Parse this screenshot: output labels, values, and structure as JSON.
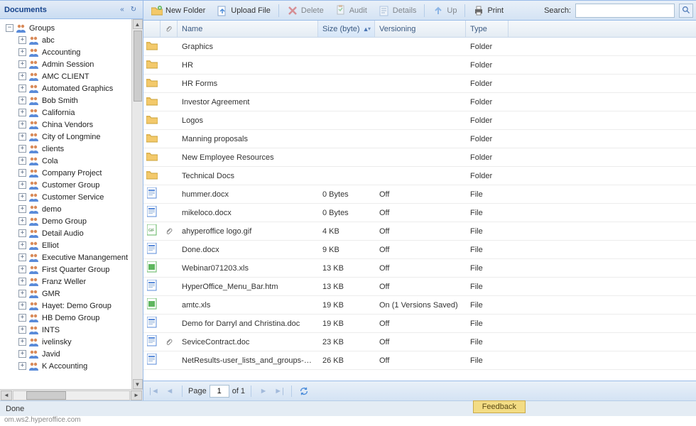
{
  "sidebar": {
    "title": "Documents",
    "root": "Groups",
    "items": [
      "abc",
      "Accounting",
      "Admin Session",
      "AMC CLIENT",
      "Automated Graphics",
      "Bob Smith",
      "California",
      "China Vendors",
      "City of Longmine",
      "clients",
      "Cola",
      "Company Project",
      "Customer Group",
      "Customer Service",
      "demo",
      "Demo Group",
      "Detail Audio",
      "Elliot",
      "Executive Manangement",
      "First Quarter Group",
      "Franz Weller",
      "GMR",
      "Hayet: Demo Group",
      "HB Demo Group",
      "INTS",
      "ivelinsky",
      "Javid",
      "K Accounting"
    ]
  },
  "toolbar": {
    "new_folder": "New Folder",
    "upload_file": "Upload File",
    "delete": "Delete",
    "audit": "Audit",
    "details": "Details",
    "up": "Up",
    "print": "Print",
    "search_label": "Search:",
    "search_placeholder": ""
  },
  "grid": {
    "columns": {
      "name": "Name",
      "size": "Size (byte)",
      "versioning": "Versioning",
      "type": "Type"
    },
    "rows": [
      {
        "icon": "folder",
        "name": "Graphics",
        "size": "",
        "versioning": "",
        "type": "Folder",
        "clip": false
      },
      {
        "icon": "folder",
        "name": "HR",
        "size": "",
        "versioning": "",
        "type": "Folder",
        "clip": false
      },
      {
        "icon": "folder",
        "name": "HR Forms",
        "size": "",
        "versioning": "",
        "type": "Folder",
        "clip": false
      },
      {
        "icon": "folder",
        "name": "Investor Agreement",
        "size": "",
        "versioning": "",
        "type": "Folder",
        "clip": false
      },
      {
        "icon": "folder",
        "name": "Logos",
        "size": "",
        "versioning": "",
        "type": "Folder",
        "clip": false
      },
      {
        "icon": "folder",
        "name": "Manning proposals",
        "size": "",
        "versioning": "",
        "type": "Folder",
        "clip": false
      },
      {
        "icon": "folder",
        "name": "New Employee Resources",
        "size": "",
        "versioning": "",
        "type": "Folder",
        "clip": false
      },
      {
        "icon": "folder",
        "name": "Technical Docs",
        "size": "",
        "versioning": "",
        "type": "Folder",
        "clip": false
      },
      {
        "icon": "doc",
        "name": "hummer.docx",
        "size": "0 Bytes",
        "versioning": "Off",
        "type": "File",
        "clip": false
      },
      {
        "icon": "doc",
        "name": "mikeloco.docx",
        "size": "0 Bytes",
        "versioning": "Off",
        "type": "File",
        "clip": false
      },
      {
        "icon": "gif",
        "name": "ahyperoffice logo.gif",
        "size": "4 KB",
        "versioning": "Off",
        "type": "File",
        "clip": true
      },
      {
        "icon": "doc",
        "name": "Done.docx",
        "size": "9 KB",
        "versioning": "Off",
        "type": "File",
        "clip": false
      },
      {
        "icon": "xls",
        "name": "Webinar071203.xls",
        "size": "13 KB",
        "versioning": "Off",
        "type": "File",
        "clip": false
      },
      {
        "icon": "doc",
        "name": "HyperOffice_Menu_Bar.htm",
        "size": "13 KB",
        "versioning": "Off",
        "type": "File",
        "clip": false
      },
      {
        "icon": "xls",
        "name": "amtc.xls",
        "size": "19 KB",
        "versioning": "On (1 Versions Saved)",
        "type": "File",
        "clip": false
      },
      {
        "icon": "doc",
        "name": "Demo for Darryl and Christina.doc",
        "size": "19 KB",
        "versioning": "Off",
        "type": "File",
        "clip": false
      },
      {
        "icon": "doc",
        "name": "SeviceContract.doc",
        "size": "23 KB",
        "versioning": "Off",
        "type": "File",
        "clip": true
      },
      {
        "icon": "doc",
        "name": "NetResults-user_lists_and_groups-2...",
        "size": "26 KB",
        "versioning": "Off",
        "type": "File",
        "clip": false
      }
    ]
  },
  "pager": {
    "page_label": "Page",
    "page": "1",
    "of_label": "of 1"
  },
  "status": {
    "text": "Done"
  },
  "feedback": "Feedback",
  "footer": "om.ws2.hyperoffice.com"
}
